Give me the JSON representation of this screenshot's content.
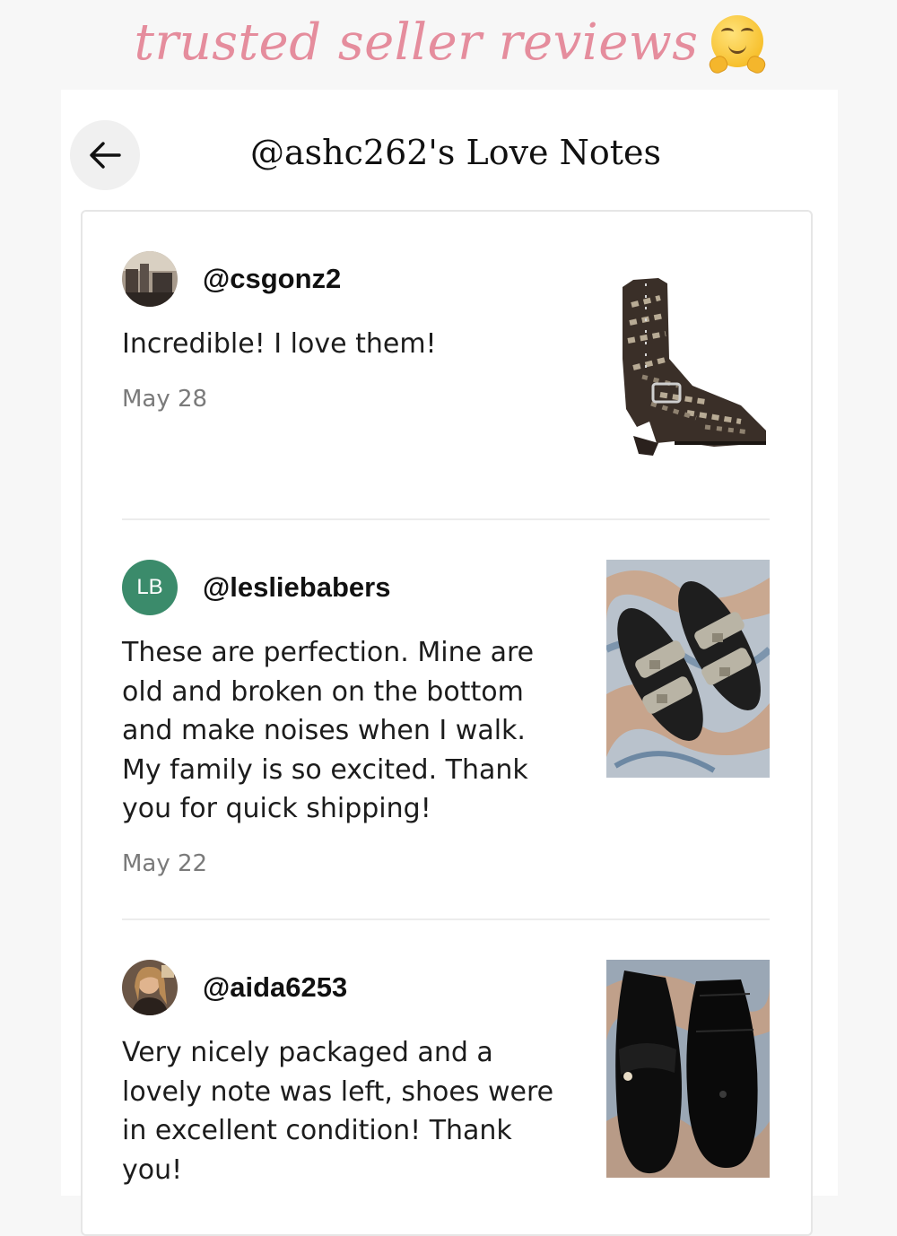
{
  "banner": {
    "text": "trusted seller reviews",
    "emoji": "hugging-face-emoji"
  },
  "header": {
    "title": "@ashc262's Love Notes",
    "back_icon": "arrow-left-icon"
  },
  "reviews": [
    {
      "username": "@csgonz2",
      "comment": "Incredible! I love them!",
      "date": "May 28",
      "avatar": "photo",
      "photo": "snakeskin-lace-up-boot"
    },
    {
      "username": "@lesliebabers",
      "initials": "LB",
      "comment": "These are perfection. Mine are old and broken on the bottom and make noises when I walk. My family is so excited. Thank you for quick shipping!",
      "date": "May 22",
      "avatar": "initials",
      "photo": "embellished-buckle-slide-sandals"
    },
    {
      "username": "@aida6253",
      "comment": "Very nicely packaged and a lovely note was left, shoes were in excellent condition! Thank you!",
      "date": "",
      "avatar": "photo",
      "photo": "black-suede-loafers"
    }
  ],
  "colors": {
    "banner_pink": "#e58d9d",
    "initials_green": "#3b8b6b",
    "date_gray": "#7a7a7a"
  }
}
